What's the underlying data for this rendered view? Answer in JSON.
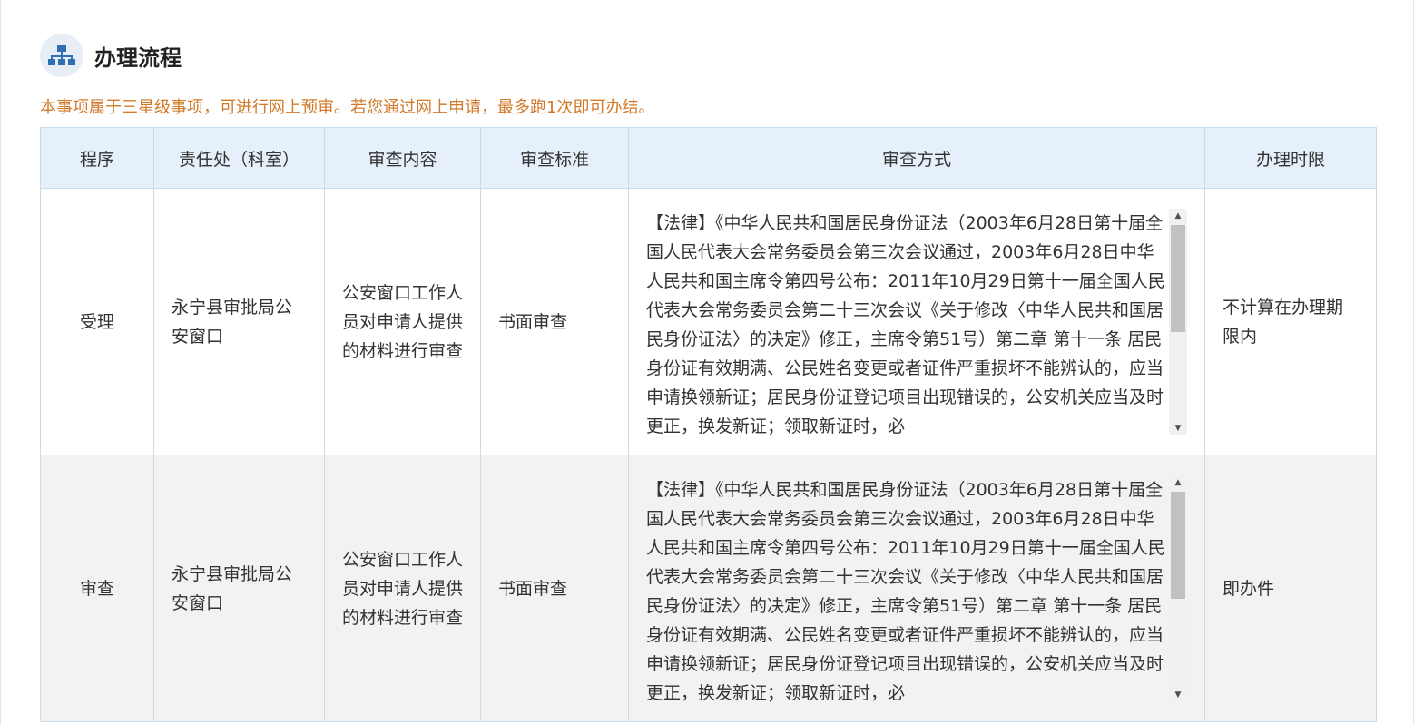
{
  "section": {
    "title": "办理流程",
    "icon": "sitemap-icon",
    "notice": "本事项属于三星级事项，可进行网上预审。若您通过网上申请，最多跑1次即可办结。"
  },
  "table": {
    "headers": [
      "程序",
      "责任处（科室）",
      "审查内容",
      "审查标准",
      "审查方式",
      "办理时限"
    ],
    "rows": [
      {
        "step": "受理",
        "dept": "永宁县审批局公安窗口",
        "content": "公安窗口工作人员对申请人提供的材料进行审查",
        "standard": "书面审查",
        "method": "【法律】《中华人民共和国居民身份证法（2003年6月28日第十届全国人民代表大会常务委员会第三次会议通过，2003年6月28日中华人民共和国主席令第四号公布：2011年10月29日第十一届全国人民代表大会常务委员会第二十三次会议《关于修改〈中华人民共和国居民身份证法〉的决定》修正，主席令第51号）第二章 第十一条 居民身份证有效期满、公民姓名变更或者证件严重损坏不能辨认的，应当申请换领新证；居民身份证登记项目出现错误的，公安机关应当及时更正，换发新证；领取新证时，必",
        "time_limit": "不计算在办理期限内"
      },
      {
        "step": "审查",
        "dept": "永宁县审批局公安窗口",
        "content": "公安窗口工作人员对申请人提供的材料进行审查",
        "standard": "书面审查",
        "method": "【法律】《中华人民共和国居民身份证法（2003年6月28日第十届全国人民代表大会常务委员会第三次会议通过，2003年6月28日中华人民共和国主席令第四号公布：2011年10月29日第十一届全国人民代表大会常务委员会第二十三次会议《关于修改〈中华人民共和国居民身份证法〉的决定》修正，主席令第51号）第二章 第十一条 居民身份证有效期满、公民姓名变更或者证件严重损坏不能辨认的，应当申请换领新证；居民身份证登记项目出现错误的，公安机关应当及时更正，换发新证；领取新证时，必",
        "time_limit": "即办件"
      }
    ]
  },
  "colors": {
    "notice": "#d27a2a",
    "header_bg": "#e6f0fa",
    "border": "#c9dcef",
    "alt_row_bg": "#f2f2f2",
    "icon_blue": "#2f6fb4"
  }
}
